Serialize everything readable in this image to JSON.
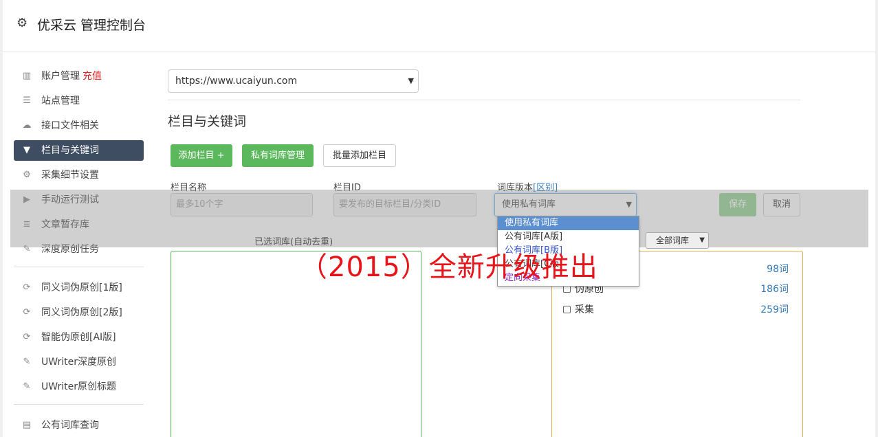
{
  "header": {
    "title": "优采云 管理控制台",
    "icon": "gear-icon"
  },
  "sidebar": {
    "group1": [
      {
        "label": "账户管理",
        "extra": "充值",
        "icon": "bar-chart-icon"
      },
      {
        "label": "站点管理",
        "icon": "server-icon"
      },
      {
        "label": "接口文件相关",
        "icon": "cloud-upload-icon"
      },
      {
        "label": "栏目与关键词",
        "icon": "filter-icon",
        "active": true
      },
      {
        "label": "采集细节设置",
        "icon": "cogs-icon"
      },
      {
        "label": "手动运行测试",
        "icon": "play-circle-icon"
      },
      {
        "label": "文章暂存库",
        "icon": "database-icon"
      },
      {
        "label": "深度原创任务",
        "icon": "edit-icon"
      }
    ],
    "group2": [
      {
        "label": "同义词伪原创[1版]",
        "icon": "refresh-icon"
      },
      {
        "label": "同义词伪原创[2版]",
        "icon": "refresh-icon"
      },
      {
        "label": "智能伪原创[AI版]",
        "icon": "refresh-icon"
      },
      {
        "label": "UWriter深度原创",
        "icon": "edit-icon"
      },
      {
        "label": "UWriter原创标题",
        "icon": "edit-icon"
      }
    ],
    "group3": [
      {
        "label": "公有词库查询",
        "icon": "book-icon"
      }
    ]
  },
  "main": {
    "site_select": "https://www.ucaiyun.com",
    "section_title": "栏目与关键词",
    "buttons": {
      "add_column": "添加栏目 +",
      "private_lib": "私有词库管理",
      "batch_add": "批量添加栏目"
    },
    "form": {
      "name_label": "栏目名称",
      "name_placeholder": "最多10个字",
      "id_label": "栏目ID",
      "id_placeholder": "要发布的目标栏目/分类ID",
      "version_label": "词库版本",
      "version_link": "[区别]",
      "version_selected": "使用私有词库",
      "save": "保存",
      "cancel": "取消"
    },
    "version_options": [
      "使用私有词库",
      "公有词库[A版]",
      "公有词库[B版]",
      "公有词库[C版]",
      "定向采集"
    ],
    "selected_label": "已选词库(自动去重)",
    "lib_filter": "全部词库",
    "libraries": [
      {
        "name": "",
        "count": "98词"
      },
      {
        "name": "伪原创",
        "count": "186词"
      },
      {
        "name": "采集",
        "count": "259词"
      }
    ]
  },
  "promo": "（2015）全新升级推出",
  "colors": {
    "accent_green": "#5cb85c",
    "sidebar_active": "#3f4d63",
    "promo_red": "#e8141a",
    "link_blue": "#337ab7"
  }
}
